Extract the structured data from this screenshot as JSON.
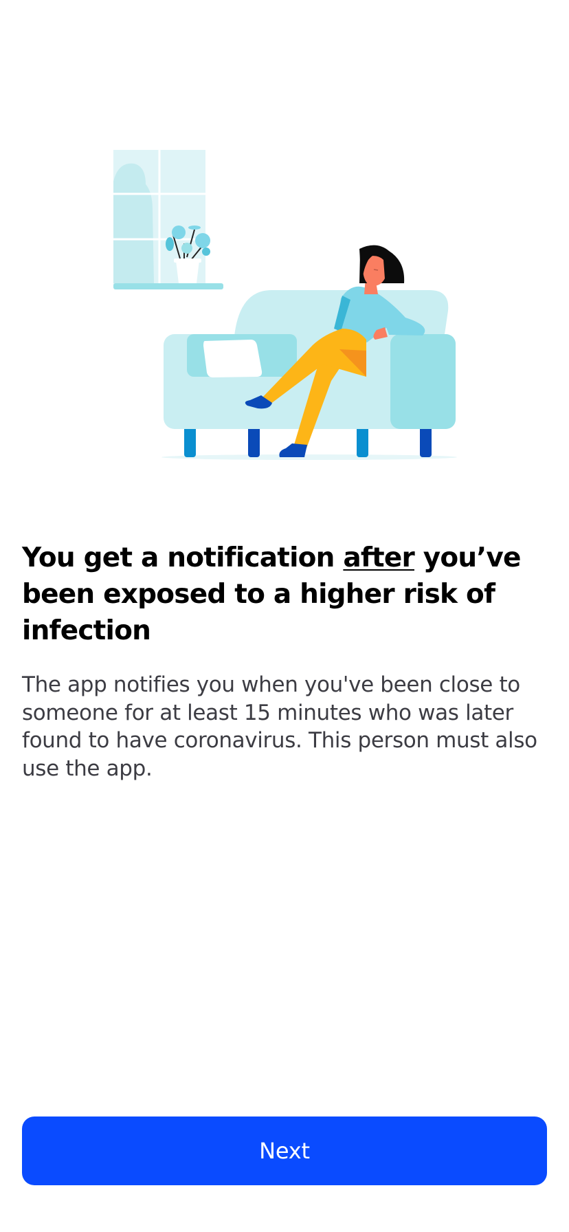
{
  "illustration": {
    "name": "person-relaxing-on-sofa",
    "colors": {
      "window": "#dff4f7",
      "sofa": "#c9eef2",
      "sofa_arm": "#98e0e7",
      "shirt": "#7fd6e8",
      "pants": "#fdb517",
      "skin": "#fa7e61",
      "hair": "#0c0c0c",
      "shoes": "#0a4ab8"
    }
  },
  "onboarding": {
    "headline_part1": "You get a notification ",
    "headline_emphasis": "after",
    "headline_part2": " you’ve been exposed to a higher risk of infection",
    "body": "The app notifies you when you've been close to someone for at least 15 minutes who was later found to have coronavirus. This person must also use the app."
  },
  "actions": {
    "next_label": "Next"
  },
  "colors": {
    "primary": "#0a4bff",
    "body_text": "#3c3c43",
    "background": "#ffffff"
  }
}
